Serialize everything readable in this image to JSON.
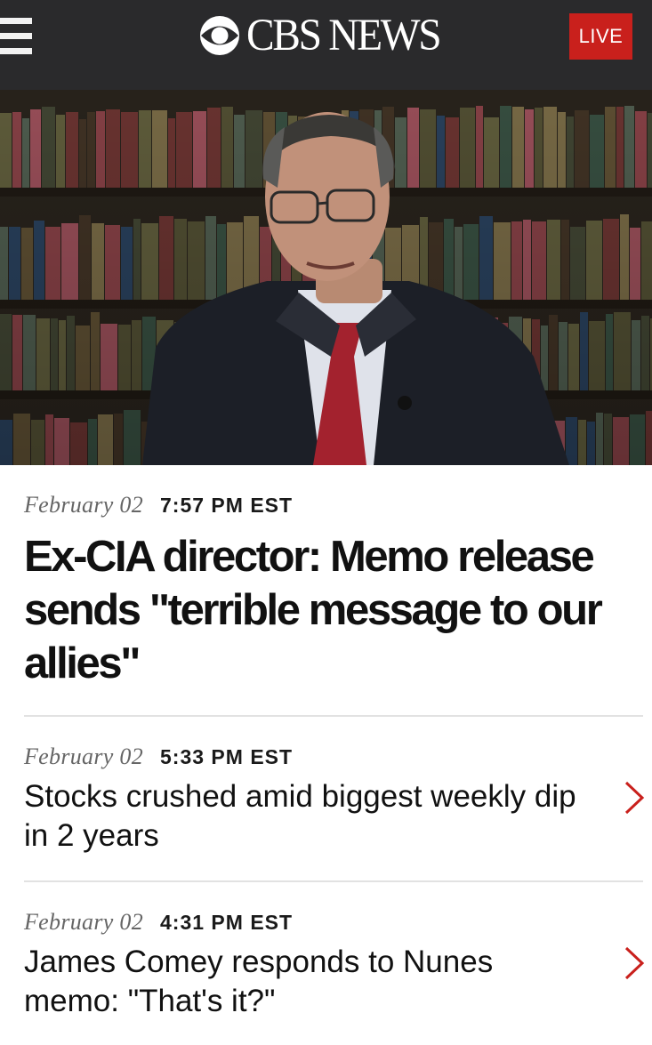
{
  "header": {
    "brand": "CBS NEWS",
    "live_label": "LIVE",
    "menu_icon": "hamburger-menu-icon",
    "logo_icon": "cbs-eye-logo-icon",
    "background": "#2a2a2c",
    "live_color": "#c9201c"
  },
  "lead_story": {
    "date": "February 02",
    "time": "7:57 PM EST",
    "headline": "Ex-CIA director: Memo release sends \"terrible message to our allies\""
  },
  "stories": [
    {
      "date": "February 02",
      "time": "5:33 PM EST",
      "headline": "Stocks crushed amid biggest weekly dip in 2 years",
      "icon": "chevron-right-icon"
    },
    {
      "date": "February 02",
      "time": "4:31 PM EST",
      "headline": "James Comey responds to Nunes memo: \"That's it?\"",
      "icon": "chevron-right-icon"
    }
  ],
  "accent_color": "#c9201c"
}
